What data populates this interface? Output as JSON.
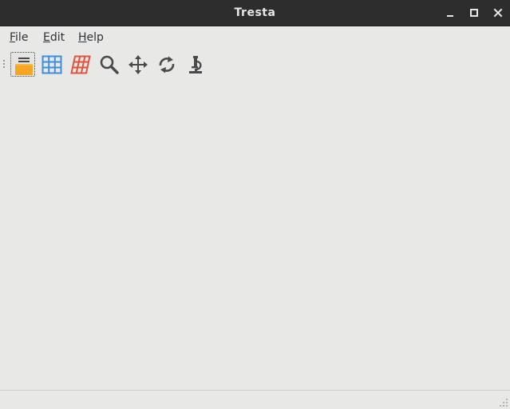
{
  "window": {
    "title": "Tresta",
    "controls": [
      "minimize-icon",
      "maximize-icon",
      "close-icon"
    ]
  },
  "menubar": {
    "items": [
      {
        "mnemonic": "F",
        "rest": "ile"
      },
      {
        "mnemonic": "E",
        "rest": "dit"
      },
      {
        "mnemonic": "H",
        "rest": "elp"
      }
    ]
  },
  "toolbar": {
    "buttons": [
      {
        "icon": "folder-open-icon",
        "active": true
      },
      {
        "icon": "grid-blue-icon",
        "active": false
      },
      {
        "icon": "grid-red-perspective-icon",
        "active": false
      },
      {
        "icon": "magnifier-icon",
        "active": false
      },
      {
        "icon": "move-arrows-icon",
        "active": false
      },
      {
        "icon": "rotate-icon",
        "active": false
      },
      {
        "icon": "microscope-icon",
        "active": false
      }
    ]
  },
  "colors": {
    "titlebar": "#2d2d2d",
    "background": "#e8e8e7",
    "folder": "#f5a623",
    "grid_blue": "#3d8ee0",
    "grid_red": "#e0533d",
    "icon_dark": "#4a4a4a"
  }
}
